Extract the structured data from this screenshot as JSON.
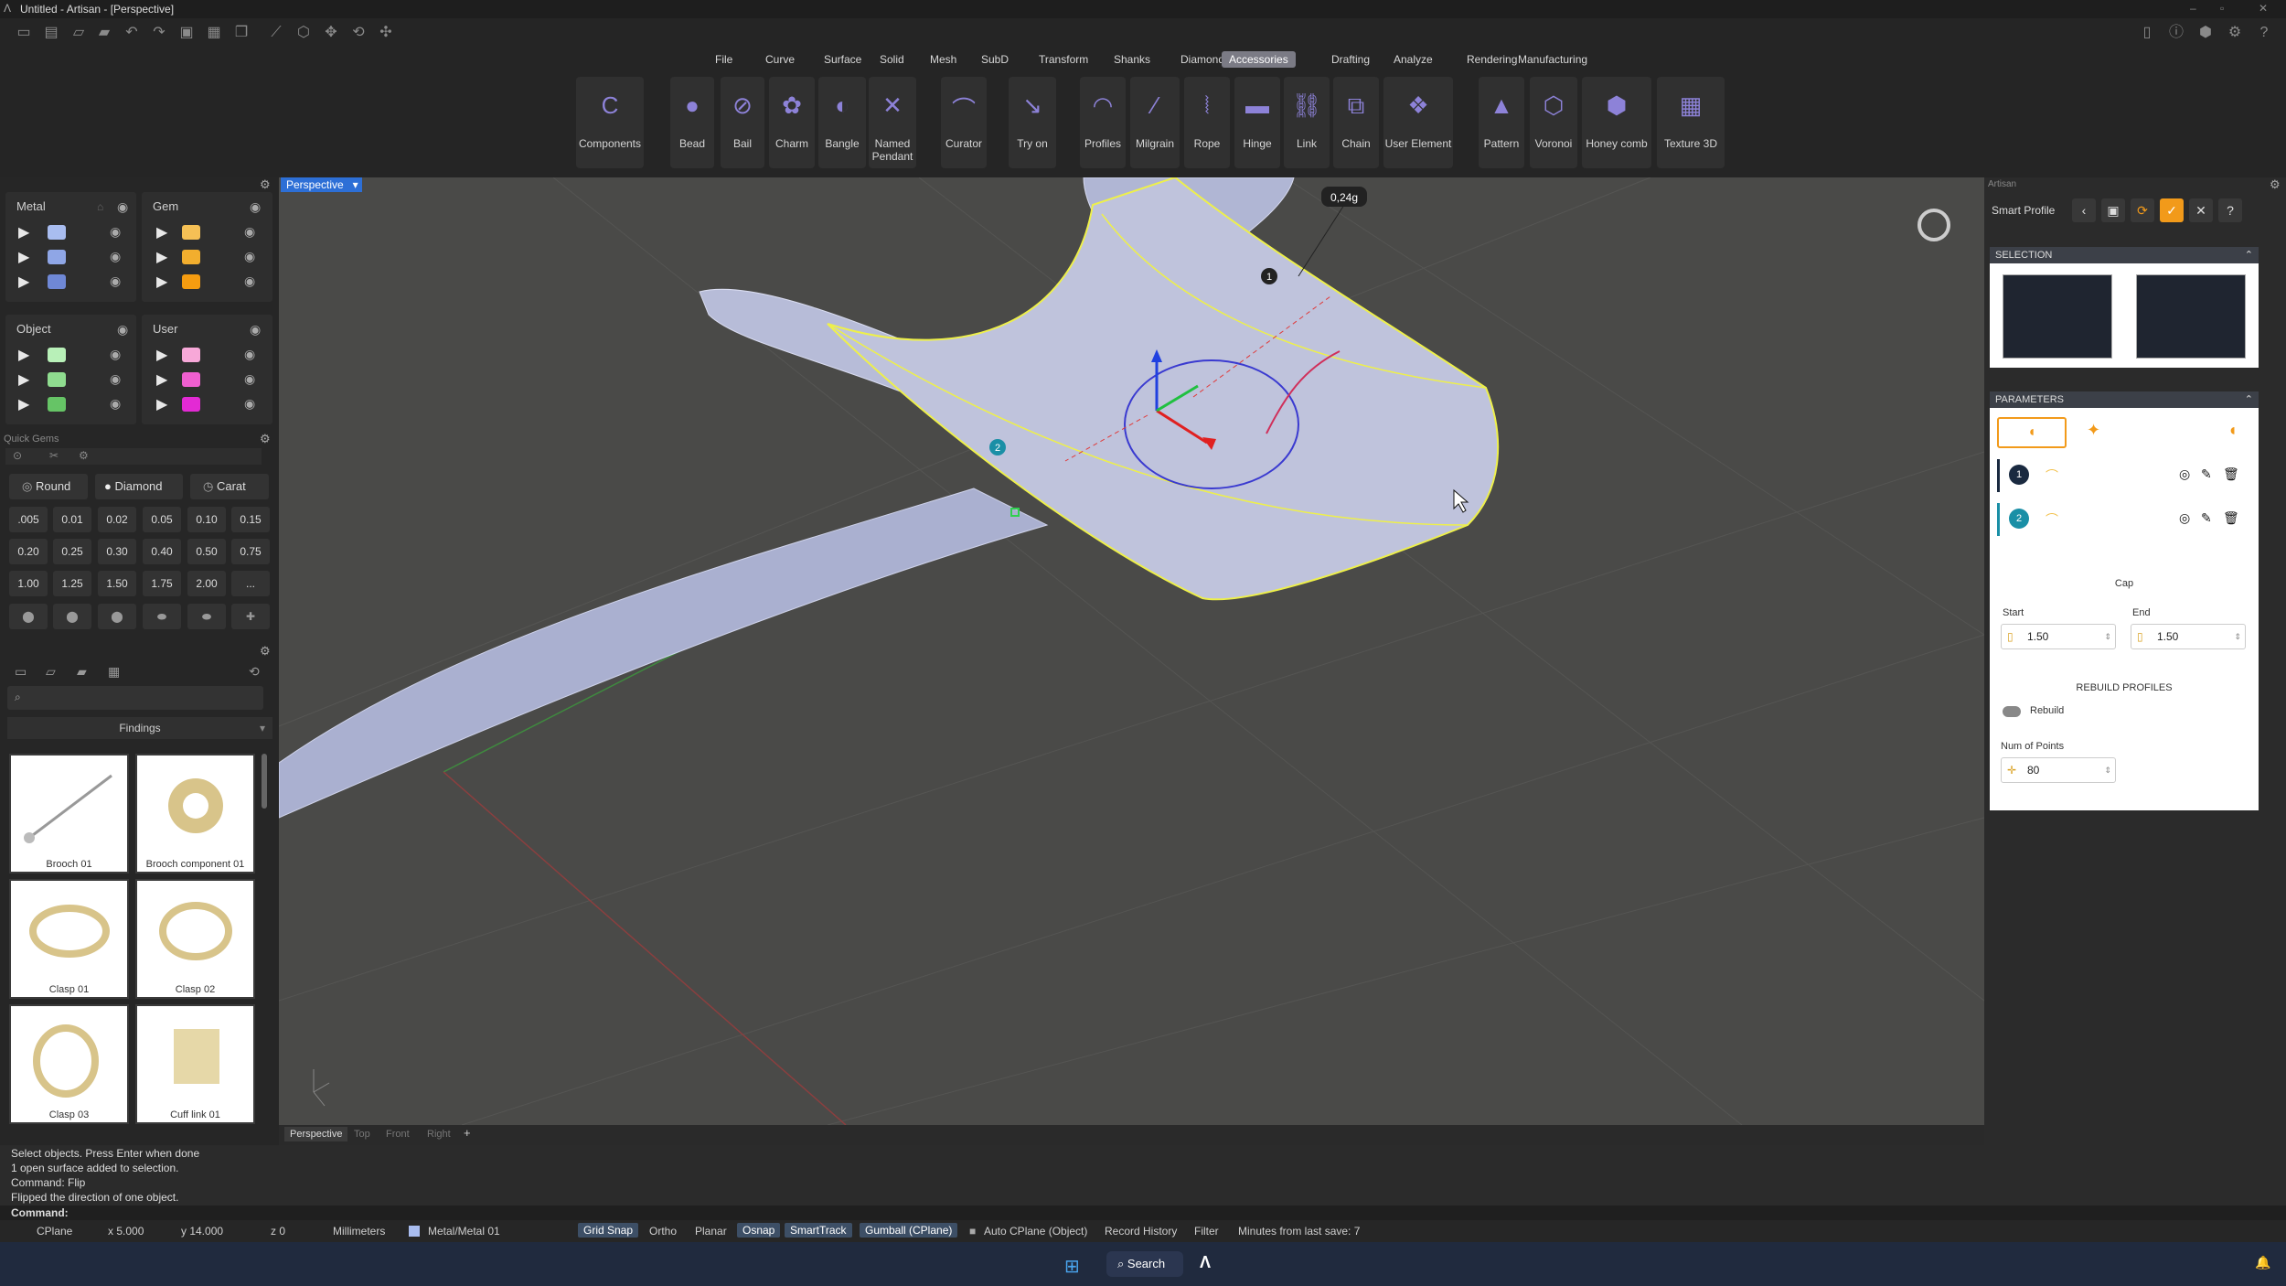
{
  "window": {
    "title": "Untitled - Artisan - [Perspective]"
  },
  "menu": [
    "File",
    "Curve",
    "Surface",
    "Solid",
    "Mesh",
    "SubD",
    "Transform",
    "Shanks",
    "Diamonds",
    "Accessories",
    "Drafting",
    "Analyze",
    "Rendering",
    "Manufacturing"
  ],
  "menu_active": "Accessories",
  "ribbon": {
    "components": "Components",
    "bead": "Bead",
    "bail": "Bail",
    "charm": "Charm",
    "bangle": "Bangle",
    "named_pendant": "Named Pendant",
    "curator": "Curator",
    "try_on": "Try on",
    "profiles": "Profiles",
    "milgrain": "Milgrain",
    "rope": "Rope",
    "hinge": "Hinge",
    "link": "Link",
    "chain": "Chain",
    "user_element": "User Element",
    "pattern": "Pattern",
    "voronoi": "Voronoi",
    "honey_comb": "Honey comb",
    "texture_3d": "Texture 3D"
  },
  "layers": {
    "metal": "Metal",
    "gem": "Gem",
    "object": "Object",
    "user": "User",
    "metal_colors": [
      "#a9bdf0",
      "#8fa6e6",
      "#6f88d6"
    ],
    "gem_colors": [
      "#f5c055",
      "#f2ae2e",
      "#f59c10"
    ],
    "object_colors": [
      "#b8f0b8",
      "#8fdc8f",
      "#66c466"
    ],
    "user_colors": [
      "#f7a8d8",
      "#ef5fd0",
      "#e32ad4"
    ]
  },
  "quick_gems": {
    "title": "Quick Gems",
    "round": "Round",
    "diamond": "Diamond",
    "carat": "Carat",
    "sizes": [
      ".005",
      "0.01",
      "0.02",
      "0.05",
      "0.10",
      "0.15",
      "0.20",
      "0.25",
      "0.30",
      "0.40",
      "0.50",
      "0.75",
      "1.00",
      "1.25",
      "1.50",
      "1.75",
      "2.00",
      "..."
    ]
  },
  "library": {
    "category": "Findings",
    "items": [
      "Brooch 01",
      "Brooch component 01",
      "Clasp 01",
      "Clasp 02",
      "Clasp 03",
      "Cuff link 01"
    ]
  },
  "viewport": {
    "name": "Perspective",
    "weight": "0,24g",
    "point1": "1",
    "point2": "2"
  },
  "view_tabs": [
    "Perspective",
    "Top",
    "Front",
    "Right"
  ],
  "right_panel": {
    "header": "Artisan",
    "tool": "Smart Profile",
    "selection": "SELECTION",
    "parameters": "PARAMETERS",
    "profile1": "1",
    "profile2": "2",
    "cap": "Cap",
    "start_label": "Start",
    "start_value": "1.50",
    "end_label": "End",
    "end_value": "1.50",
    "rebuild_section": "REBUILD PROFILES",
    "rebuild": "Rebuild",
    "num_points_label": "Num of Points",
    "num_points_value": "80"
  },
  "command": {
    "lines": [
      "Select objects. Press Enter when done",
      "1 open surface added to selection.",
      "Command: Flip",
      "Flipped the direction of one object."
    ],
    "prompt": "Command:"
  },
  "status": {
    "cplane": "CPlane",
    "x": "x 5.000",
    "y": "y 14.000",
    "z": "z 0",
    "units": "Millimeters",
    "layer": "Metal/Metal 01",
    "grid_snap": "Grid Snap",
    "ortho": "Ortho",
    "planar": "Planar",
    "osnap": "Osnap",
    "smarttrack": "SmartTrack",
    "gumball": "Gumball (CPlane)",
    "auto_cplane": "Auto CPlane (Object)",
    "record_history": "Record History",
    "filter": "Filter",
    "minutes": "Minutes from last save: 7"
  },
  "taskbar": {
    "search": "Search"
  }
}
